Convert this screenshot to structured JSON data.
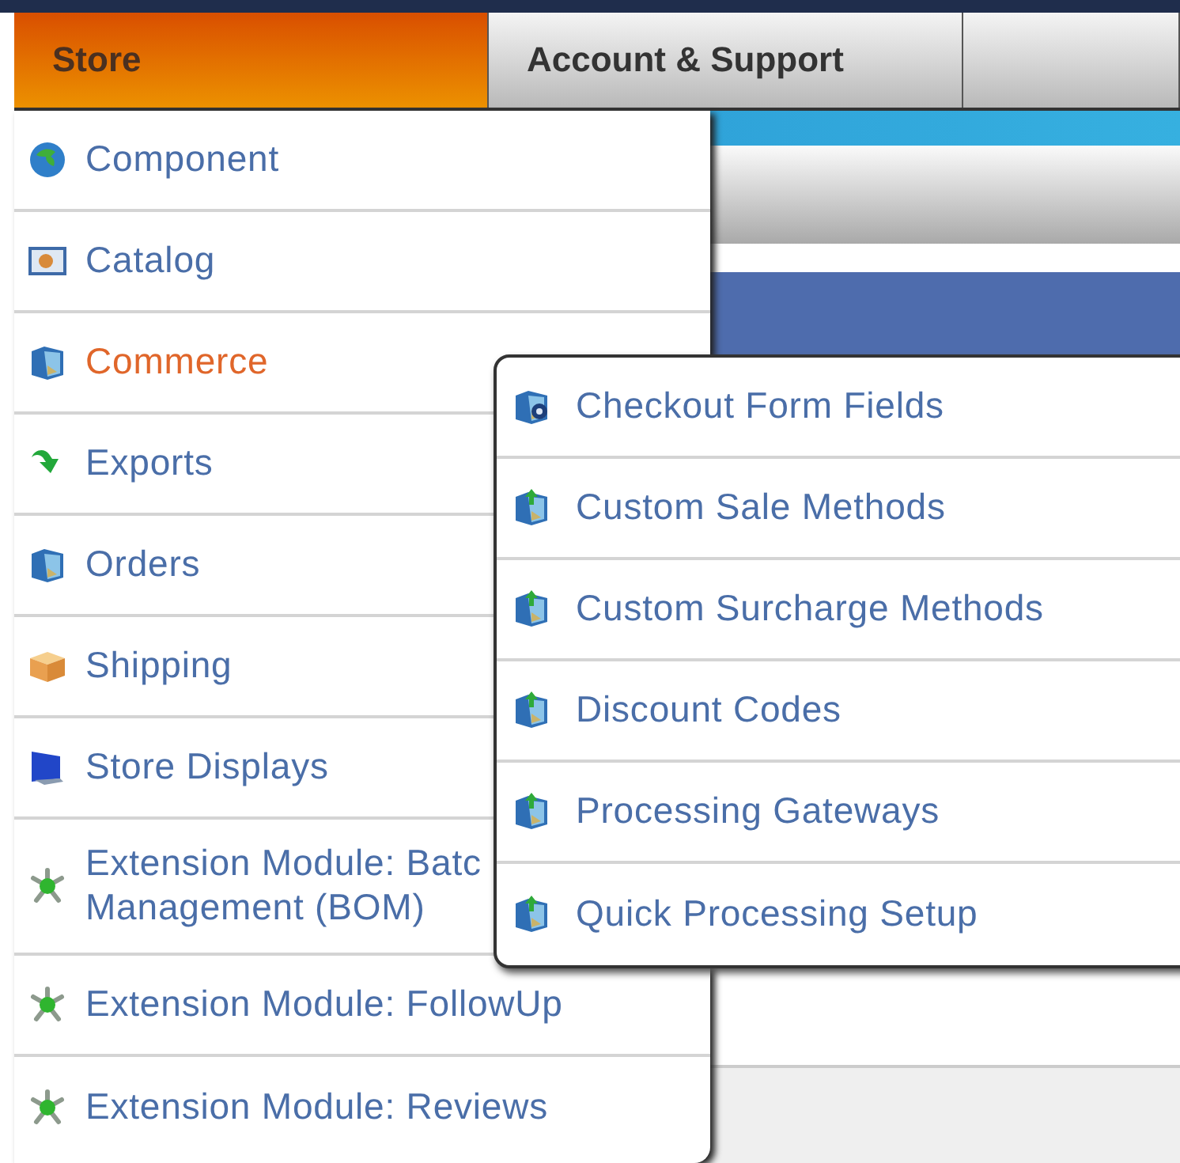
{
  "tabs": [
    {
      "label": "Store",
      "selected": true
    },
    {
      "label": "Account & Support",
      "selected": false
    }
  ],
  "store_menu": {
    "items": [
      {
        "kind": "globe",
        "lines": [
          "Component"
        ],
        "selected": false
      },
      {
        "kind": "catalog",
        "lines": [
          "Catalog"
        ],
        "selected": false
      },
      {
        "kind": "cube",
        "lines": [
          "Commerce"
        ],
        "selected": true
      },
      {
        "kind": "arrow",
        "lines": [
          "Exports"
        ],
        "selected": false
      },
      {
        "kind": "cube",
        "lines": [
          "Orders"
        ],
        "selected": false
      },
      {
        "kind": "parcel",
        "lines": [
          "Shipping"
        ],
        "selected": false
      },
      {
        "kind": "monitor",
        "lines": [
          "Store Displays"
        ],
        "selected": false
      },
      {
        "kind": "module",
        "lines": [
          "Extension Module: Batc",
          "Management (BOM)"
        ],
        "selected": false
      },
      {
        "kind": "module",
        "lines": [
          "Extension Module: FollowUp"
        ],
        "selected": false
      },
      {
        "kind": "module",
        "lines": [
          "Extension Module: Reviews"
        ],
        "selected": false
      }
    ]
  },
  "commerce_submenu": {
    "items": [
      {
        "kind": "cube-gear",
        "label": "Checkout Form Fields"
      },
      {
        "kind": "cube-arrow",
        "label": "Custom Sale Methods"
      },
      {
        "kind": "cube-arrow",
        "label": "Custom Surcharge Methods"
      },
      {
        "kind": "cube-arrow",
        "label": "Discount Codes"
      },
      {
        "kind": "cube-arrow",
        "label": "Processing Gateways"
      },
      {
        "kind": "cube-arrow",
        "label": "Quick Processing Setup"
      }
    ]
  }
}
